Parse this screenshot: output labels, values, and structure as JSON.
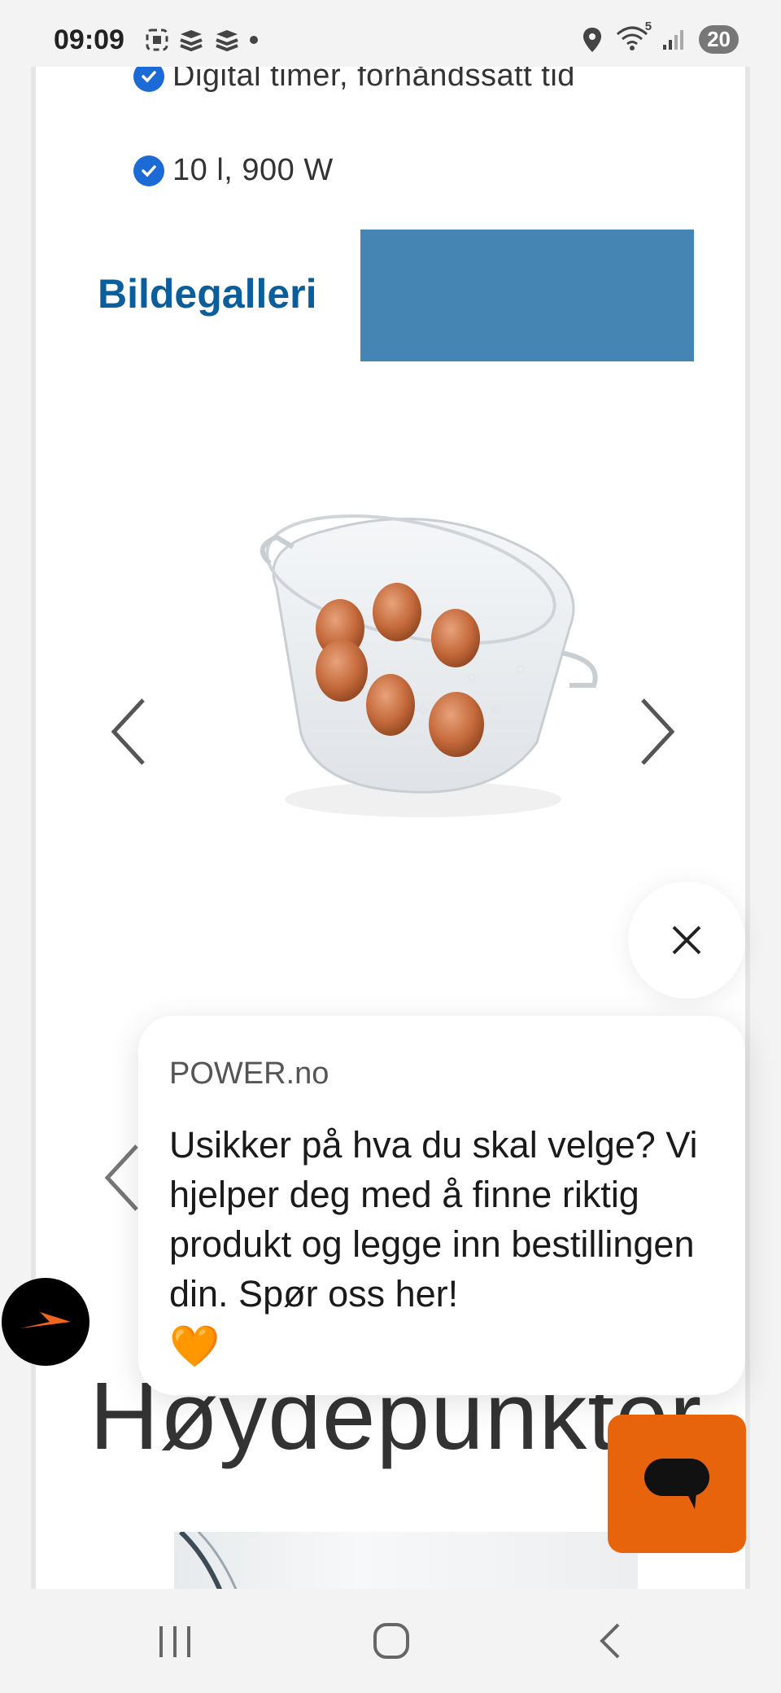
{
  "status_bar": {
    "time": "09:09",
    "network": "5",
    "battery": "20"
  },
  "features": [
    {
      "text": "Digital timer, forhåndssatt tid",
      "icon": "check-badge-icon"
    },
    {
      "text": "10 l, 900 W",
      "icon": "check-badge-icon"
    }
  ],
  "gallery": {
    "title": "Bildegalleri",
    "image_alt": "egg-tray-image",
    "prev_icon": "chevron-left-icon",
    "next_icon": "chevron-right-icon"
  },
  "chat_popup": {
    "source": "POWER.no",
    "message": "Usikker på hva du skal velge? Vi hjelper deg med å finne riktig produkt og legge inn bestillingen din. Spør oss her!",
    "emoji": "🧡"
  },
  "section": {
    "heading": "Høydepunkter"
  },
  "colors": {
    "accent_blue": "#0b5e9c",
    "block_blue": "#4485b4",
    "chat_orange": "#e8640c",
    "check_blue": "#1b6ad6"
  }
}
